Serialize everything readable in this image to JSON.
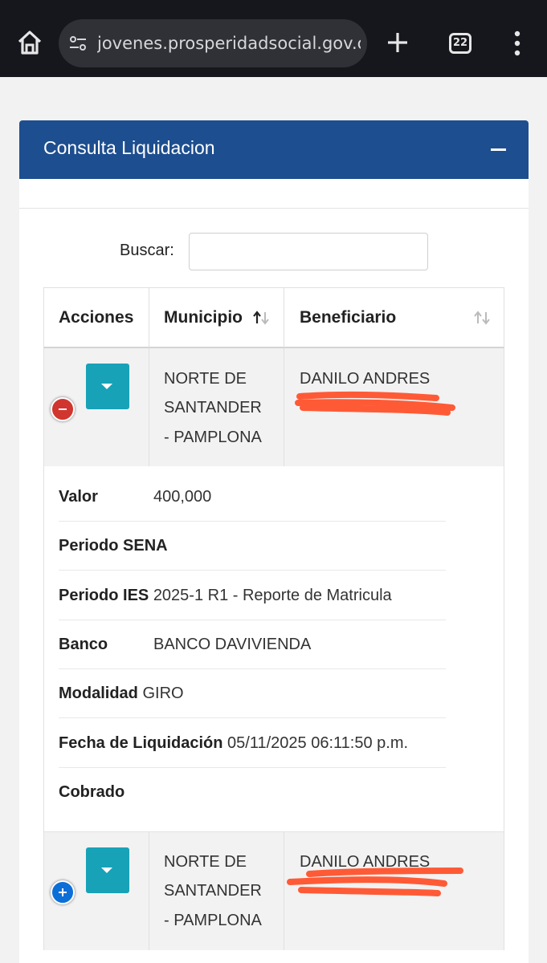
{
  "browser": {
    "url": "jovenes.prosperidadsocial.gov.co/P",
    "tab_count": "22",
    "icons": [
      "home-icon",
      "site-settings-icon",
      "new-tab-icon",
      "tab-switcher-icon",
      "menu-icon"
    ]
  },
  "panel": {
    "title": "Consulta Liquidacion",
    "header_color": "#1d4e8f"
  },
  "search": {
    "label": "Buscar:",
    "value": ""
  },
  "table": {
    "columns": [
      "Acciones",
      "Municipio",
      "Beneficiario"
    ],
    "rows": [
      {
        "municipio": [
          "NORTE DE",
          "SANTANDER",
          "- PAMPLONA"
        ],
        "beneficiario": "DANILO ANDRES",
        "expanded": true
      },
      {
        "municipio": [
          "NORTE DE",
          "SANTANDER",
          "- PAMPLONA"
        ],
        "beneficiario": "DANILO ANDRES",
        "expanded": false
      }
    ],
    "details": [
      {
        "label": "Valor",
        "value": "400,000"
      },
      {
        "label": "Periodo SENA",
        "value": ""
      },
      {
        "label": "Periodo IES",
        "value": "2025-1 R1 - Reporte de Matricula"
      },
      {
        "label": "Banco",
        "value": "BANCO DAVIVIENDA"
      },
      {
        "label": "Modalidad",
        "value": "GIRO"
      },
      {
        "label": "Fecha de Liquidación",
        "value": "05/11/2025 06:11:50 p.m."
      },
      {
        "label": "Cobrado",
        "value": ""
      }
    ]
  },
  "colors": {
    "action_button": "#17a2b8",
    "expanded_toggle": "#d1352f",
    "collapsed_toggle": "#0c6fd8",
    "redaction": "#ff5a36"
  }
}
